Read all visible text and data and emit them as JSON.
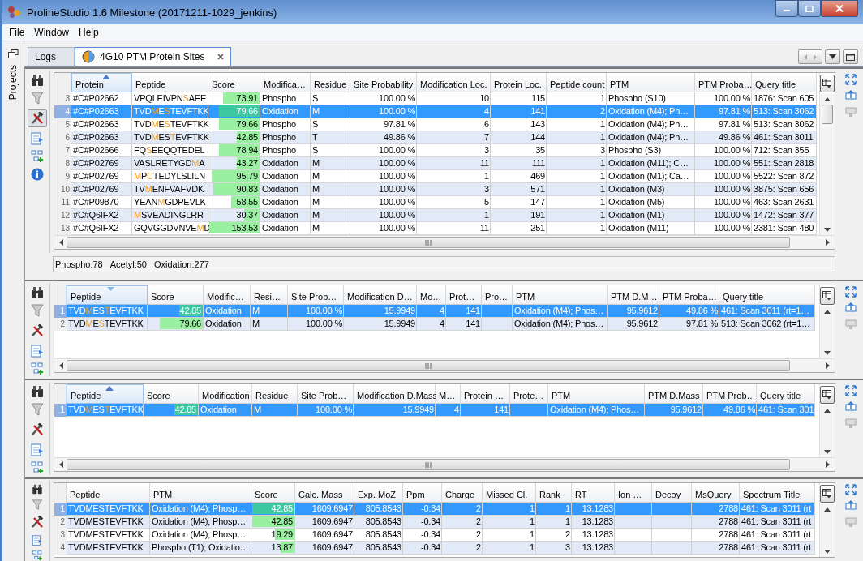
{
  "window": {
    "title": "ProlineStudio 1.6  Milestone (20171211-1029_jenkins)"
  },
  "menu": [
    "File",
    "Window",
    "Help"
  ],
  "side_label": "Projects",
  "tabs": [
    {
      "label": "Logs",
      "selected": false
    },
    {
      "label": "4G10 PTM Protein Sites",
      "selected": true
    }
  ],
  "panels": [
    {
      "tools_active": true,
      "table": {
        "columns": [
          {
            "label": "Protein",
            "kind": "text",
            "sorted": true,
            "descending": false
          },
          {
            "label": "Peptide",
            "kind": "pep",
            "sorted": false
          },
          {
            "label": "Score",
            "kind": "score",
            "sorted": false
          },
          {
            "label": "Modifica…",
            "kind": "text",
            "sorted": false
          },
          {
            "label": "Residue",
            "kind": "text",
            "sorted": false
          },
          {
            "label": "Site Probability",
            "kind": "num",
            "sorted": false
          },
          {
            "label": "Modification Loc.",
            "kind": "num",
            "sorted": false
          },
          {
            "label": "Protein Loc.",
            "kind": "num",
            "sorted": false
          },
          {
            "label": "Peptide count",
            "kind": "num",
            "sorted": false
          },
          {
            "label": "PTM",
            "kind": "text",
            "sorted": false
          },
          {
            "label": "PTM Proba…",
            "kind": "num",
            "sorted": false
          },
          {
            "label": "Query title",
            "kind": "text",
            "sorted": false
          }
        ],
        "rows": [
          {
            "num": "3",
            "selected": false,
            "cells": [
              "#C#P02662",
              [
                {
                  "t": "VPQLEIVPN",
                  "mod": false
                },
                {
                  "t": "S",
                  "mod": true
                },
                {
                  "t": "AEE",
                  "mod": false
                }
              ],
              {
                "text": "73.91",
                "level": 0.72
              },
              "Phospho",
              "S",
              "100.00 %",
              "10",
              "115",
              "1",
              "Phospho (S10)",
              "100.00 %",
              "1876: Scan 605"
            ]
          },
          {
            "num": "4",
            "selected": true,
            "cells": [
              "#C#P02663",
              [
                {
                  "t": "TVD",
                  "mod": false
                },
                {
                  "t": "M",
                  "mod": true
                },
                {
                  "t": "E",
                  "mod": false
                },
                {
                  "t": "S",
                  "mod": true
                },
                {
                  "t": "TEVFTKK",
                  "mod": false
                }
              ],
              {
                "text": "79.66",
                "level": 0.79
              },
              "Oxidation",
              "M",
              "100.00 %",
              "4",
              "141",
              "2",
              "Oxidation (M4); Ph…",
              "97.81 %",
              "513: Scan 3062"
            ]
          },
          {
            "num": "5",
            "selected": false,
            "cells": [
              "#C#P02663",
              [
                {
                  "t": "TVD",
                  "mod": false
                },
                {
                  "t": "M",
                  "mod": true
                },
                {
                  "t": "E",
                  "mod": false
                },
                {
                  "t": "S",
                  "mod": true
                },
                {
                  "t": "TEVFTKK",
                  "mod": false
                }
              ],
              {
                "text": "79.66",
                "level": 0.79
              },
              "Phospho",
              "S",
              "97.81 %",
              "6",
              "143",
              "1",
              "Oxidation (M4); Ph…",
              "97.81 %",
              "513: Scan 3062"
            ]
          },
          {
            "num": "6",
            "selected": false,
            "cells": [
              "#C#P02663",
              [
                {
                  "t": "TVD",
                  "mod": false
                },
                {
                  "t": "M",
                  "mod": true
                },
                {
                  "t": "ES",
                  "mod": false
                },
                {
                  "t": "T",
                  "mod": true
                },
                {
                  "t": "EVFTKK",
                  "mod": false
                }
              ],
              {
                "text": "42.85",
                "level": 0.44
              },
              "Phospho",
              "T",
              "49.86 %",
              "7",
              "144",
              "1",
              "Oxidation (M4); Ph…",
              "49.86 %",
              "461: Scan 3011"
            ]
          },
          {
            "num": "7",
            "selected": false,
            "cells": [
              "#C#P02666",
              [
                {
                  "t": "FQ",
                  "mod": false
                },
                {
                  "t": "S",
                  "mod": true
                },
                {
                  "t": "EEQQTEDEL",
                  "mod": false
                }
              ],
              {
                "text": "78.94",
                "level": 0.79
              },
              "Phospho",
              "S",
              "100.00 %",
              "3",
              "35",
              "3",
              "Phospho (S3)",
              "100.00 %",
              "712: Scan 355"
            ]
          },
          {
            "num": "8",
            "selected": false,
            "cells": [
              "#C#P02769",
              [
                {
                  "t": "VASLRETYGD",
                  "mod": false
                },
                {
                  "t": "M",
                  "mod": true
                },
                {
                  "t": "A",
                  "mod": false
                }
              ],
              {
                "text": "43.27",
                "level": 0.44
              },
              "Oxidation",
              "M",
              "100.00 %",
              "11",
              "111",
              "1",
              "Oxidation (M11); C…",
              "100.00 %",
              "551: Scan 2818"
            ]
          },
          {
            "num": "9",
            "selected": false,
            "cells": [
              "#C#P02769",
              [
                {
                  "t": "M",
                  "mod": true
                },
                {
                  "t": "P",
                  "mod": false
                },
                {
                  "t": "C",
                  "mod": true
                },
                {
                  "t": "TEDYLSLILN",
                  "mod": false
                }
              ],
              {
                "text": "95.79",
                "level": 0.94
              },
              "Oxidation",
              "M",
              "100.00 %",
              "1",
              "469",
              "1",
              "Oxidation (M1); Ca…",
              "100.00 %",
              "5522: Scan 872"
            ]
          },
          {
            "num": "10",
            "selected": false,
            "cells": [
              "#C#P02769",
              [
                {
                  "t": "TV",
                  "mod": false
                },
                {
                  "t": "M",
                  "mod": true
                },
                {
                  "t": "ENFVAFVDK",
                  "mod": false
                }
              ],
              {
                "text": "90.83",
                "level": 0.9
              },
              "Oxidation",
              "M",
              "100.00 %",
              "3",
              "571",
              "1",
              "Oxidation (M3)",
              "100.00 %",
              "3875: Scan 656"
            ]
          },
          {
            "num": "11",
            "selected": false,
            "cells": [
              "#C#P09870",
              [
                {
                  "t": "YEAN",
                  "mod": false
                },
                {
                  "t": "M",
                  "mod": true
                },
                {
                  "t": "GDPEVLK",
                  "mod": false
                }
              ],
              {
                "text": "58.55",
                "level": 0.56
              },
              "Oxidation",
              "M",
              "100.00 %",
              "5",
              "147",
              "1",
              "Oxidation (M5)",
              "100.00 %",
              "463: Scan 2631"
            ]
          },
          {
            "num": "12",
            "selected": false,
            "cells": [
              "#C#Q6IFX2",
              [
                {
                  "t": "M",
                  "mod": true
                },
                {
                  "t": "SVEADINGLRR",
                  "mod": false
                }
              ],
              {
                "text": "30.37",
                "level": 0.3
              },
              "Oxidation",
              "M",
              "100.00 %",
              "1",
              "191",
              "1",
              "Oxidation (M1)",
              "100.00 %",
              "1472: Scan 377"
            ]
          },
          {
            "num": "13",
            "selected": false,
            "cells": [
              "#C#Q6IFX2",
              [
                {
                  "t": "GQVGGDVNVE",
                  "mod": false
                },
                {
                  "t": "M",
                  "mod": true
                },
                {
                  "t": "D",
                  "mod": false
                }
              ],
              {
                "text": "153.53",
                "level": 0.98
              },
              "Oxidation",
              "M",
              "100.00 %",
              "11",
              "251",
              "1",
              "Oxidation (M11)",
              "100.00 %",
              "2381: Scan 480"
            ]
          }
        ]
      },
      "status": [
        "Phospho:78",
        "Acetyl:50",
        "Oxidation:277"
      ]
    },
    {
      "tools_active": false,
      "table": {
        "columns": [
          {
            "label": "Peptide",
            "kind": "pep",
            "sorted": true,
            "descending": true
          },
          {
            "label": "Score",
            "kind": "score",
            "sorted": false
          },
          {
            "label": "Modific…",
            "kind": "text",
            "sorted": false
          },
          {
            "label": "Resi…",
            "kind": "text",
            "sorted": false
          },
          {
            "label": "Site Prob…",
            "kind": "num",
            "sorted": false
          },
          {
            "label": "Modification D…",
            "kind": "num",
            "sorted": false
          },
          {
            "label": "Mo…",
            "kind": "num",
            "sorted": false
          },
          {
            "label": "Prot…",
            "kind": "num",
            "sorted": false
          },
          {
            "label": "Pro…",
            "sorted": false
          },
          {
            "label": "PTM",
            "kind": "text",
            "sorted": false
          },
          {
            "label": "PTM D.M…",
            "kind": "num",
            "sorted": false
          },
          {
            "label": "PTM Proba…",
            "kind": "num",
            "sorted": false
          },
          {
            "label": "Query title",
            "kind": "text",
            "sorted": false
          }
        ],
        "rows": [
          {
            "num": "1",
            "selected": true,
            "cells": [
              [
                {
                  "t": "TVD",
                  "mod": false
                },
                {
                  "t": "M",
                  "mod": true
                },
                {
                  "t": "ES",
                  "mod": false
                },
                {
                  "t": "T",
                  "mod": true
                },
                {
                  "t": "EVFTKK",
                  "mod": false
                }
              ],
              {
                "text": "42.85",
                "level": 0.43
              },
              "Oxidation",
              "M",
              "100.00 %",
              "15.9949",
              "4",
              "141",
              null,
              "Oxidation (M4); Phos…",
              "95.9612",
              "49.86 %",
              "461: Scan 3011 (rt=1…"
            ]
          },
          {
            "num": "2",
            "selected": false,
            "cells": [
              [
                {
                  "t": "TVD",
                  "mod": false
                },
                {
                  "t": "M",
                  "mod": true
                },
                {
                  "t": "E",
                  "mod": false
                },
                {
                  "t": "S",
                  "mod": true
                },
                {
                  "t": "TEVFTKK",
                  "mod": false
                }
              ],
              {
                "text": "79.66",
                "level": 0.78
              },
              "Oxidation",
              "M",
              "100.00 %",
              "15.9949",
              "4",
              "141",
              null,
              "Oxidation (M4); Phos…",
              "95.9612",
              "97.81 %",
              "513: Scan 3062 (rt=1…"
            ]
          }
        ]
      }
    },
    {
      "tools_active": false,
      "table": {
        "columns": [
          {
            "label": "Peptide",
            "kind": "pep",
            "sorted": true,
            "descending": false
          },
          {
            "label": "Score",
            "kind": "score",
            "sorted": false
          },
          {
            "label": "Modification",
            "kind": "text",
            "sorted": false
          },
          {
            "label": "Residue",
            "kind": "text",
            "sorted": false
          },
          {
            "label": "Site Prob…",
            "kind": "num",
            "sorted": false
          },
          {
            "label": "Modification D.Mass",
            "kind": "num",
            "sorted": false
          },
          {
            "label": "M…",
            "kind": "num",
            "sorted": false
          },
          {
            "label": "Protein …",
            "kind": "num",
            "sorted": false
          },
          {
            "label": "Prote…",
            "sorted": false
          },
          {
            "label": "PTM",
            "kind": "text",
            "sorted": false
          },
          {
            "label": "PTM D.Mass",
            "kind": "num",
            "sorted": false
          },
          {
            "label": "PTM Prob…",
            "kind": "num",
            "sorted": false
          },
          {
            "label": "Query title",
            "kind": "text",
            "sorted": false
          }
        ],
        "rows": [
          {
            "num": "1",
            "selected": true,
            "cells": [
              [
                {
                  "t": "TVD",
                  "mod": false
                },
                {
                  "t": "M",
                  "mod": true
                },
                {
                  "t": "ES",
                  "mod": false
                },
                {
                  "t": "T",
                  "mod": true
                },
                {
                  "t": "EVFTKK",
                  "mod": false
                }
              ],
              {
                "text": "42.85",
                "level": 0.43
              },
              "Oxidation",
              "M",
              "100.00 %",
              "15.9949",
              "4",
              "141",
              null,
              "Oxidation (M4); Phos…",
              "95.9612",
              "49.86 %",
              "461: Scan 301"
            ]
          }
        ]
      }
    },
    {
      "tools_active": false,
      "table": {
        "columns": [
          {
            "label": "Peptide",
            "kind": "pep",
            "sorted": false
          },
          {
            "label": "PTM",
            "kind": "text",
            "sorted": false
          },
          {
            "label": "Score",
            "kind": "score",
            "sorted": false
          },
          {
            "label": "Calc. Mass",
            "kind": "num",
            "sorted": false
          },
          {
            "label": "Exp. MoZ",
            "kind": "num",
            "sorted": false
          },
          {
            "label": "Ppm",
            "kind": "num",
            "sorted": false
          },
          {
            "label": "Charge",
            "kind": "num",
            "sorted": false
          },
          {
            "label": "Missed Cl.",
            "kind": "num",
            "sorted": false
          },
          {
            "label": "Rank",
            "kind": "num",
            "sorted": false
          },
          {
            "label": "RT",
            "kind": "num",
            "sorted": false
          },
          {
            "label": "Ion …",
            "sorted": false
          },
          {
            "label": "Decoy",
            "sorted": false
          },
          {
            "label": "MsQuery",
            "kind": "num",
            "sorted": false
          },
          {
            "label": "Spectrum Title",
            "kind": "text",
            "sorted": false
          }
        ],
        "rows": [
          {
            "num": "1",
            "selected": true,
            "cells": [
              [
                {
                  "t": "TVDMESTEVFTKK",
                  "mod": false
                }
              ],
              "Oxidation (M4); Phosp…",
              {
                "text": "42.85",
                "level": 0.98
              },
              "1609.6947",
              "805.8543",
              "-0.34",
              "2",
              "1",
              "1",
              "13.1283",
              null,
              null,
              "2788",
              "461: Scan 3011 (rt"
            ]
          },
          {
            "num": "2",
            "selected": false,
            "cells": [
              [
                {
                  "t": "TVDMESTEVFTKK",
                  "mod": false
                }
              ],
              "Oxidation (M4); Phosp…",
              {
                "text": "42.85",
                "level": 0.98
              },
              "1609.6947",
              "805.8543",
              "-0.34",
              "2",
              "1",
              "1",
              "13.1283",
              null,
              null,
              "2788",
              "461: Scan 3011 (rt"
            ]
          },
          {
            "num": "3",
            "selected": false,
            "cells": [
              [
                {
                  "t": "TVDMESTEVFTKK",
                  "mod": false
                }
              ],
              "Oxidation (M4); Phosp…",
              {
                "text": "19.29",
                "level": 0.46
              },
              "1609.6947",
              "805.8543",
              "-0.34",
              "2",
              "1",
              "2",
              "13.1283",
              null,
              null,
              "2788",
              "461: Scan 3011 (rt"
            ]
          },
          {
            "num": "4",
            "selected": false,
            "cells": [
              [
                {
                  "t": "TVDMESTEVFTKK",
                  "mod": false
                }
              ],
              "Phospho (T1); Oxidatio…",
              {
                "text": "13.87",
                "level": 0.33
              },
              "1609.6947",
              "805.8543",
              "-0.34",
              "2",
              "1",
              "3",
              "13.1283",
              null,
              null,
              "2788",
              "461: Scan 3011 (rt"
            ]
          }
        ]
      }
    }
  ]
}
